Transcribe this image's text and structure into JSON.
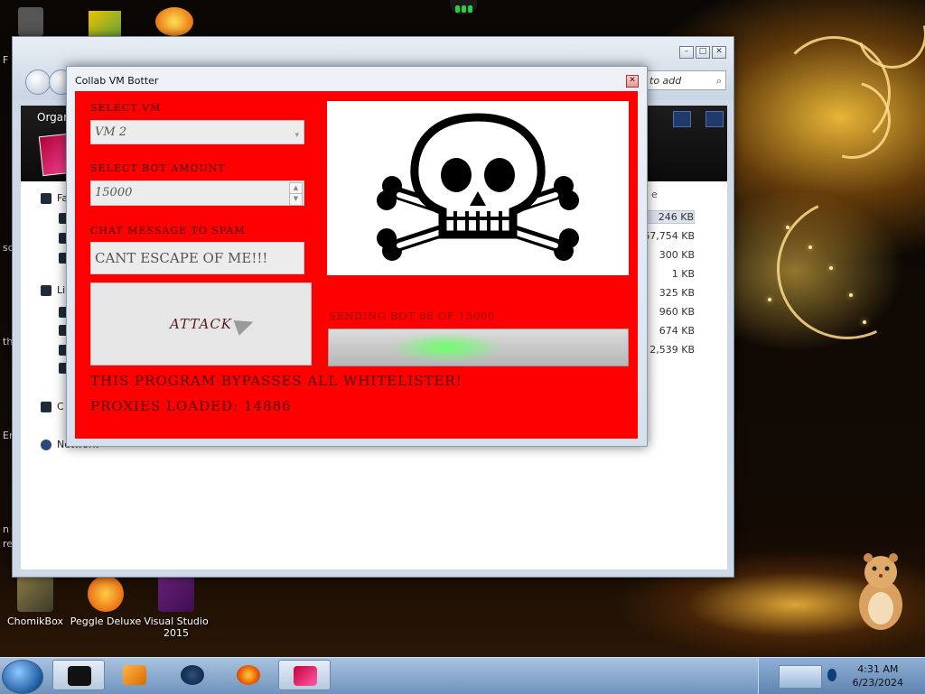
{
  "desktop": {
    "icons": [
      {
        "label": "ChomikBox"
      },
      {
        "label": "Peggle Deluxe"
      },
      {
        "label": "Visual Studio 2015"
      }
    ],
    "left_clipped": [
      "sc",
      "th",
      "Er",
      "n",
      "re",
      "F"
    ]
  },
  "explorer": {
    "search_placeholder": "to add",
    "organize": "Organ",
    "nav_items": [
      "Fa",
      "Li",
      "C",
      "Network"
    ],
    "column_partial": "e",
    "sizes": [
      "246 KB",
      "67,754 KB",
      "300 KB",
      "1 KB",
      "325 KB",
      "960 KB",
      "674 KB",
      "2,539 KB"
    ]
  },
  "botter": {
    "title": "Collab VM Botter",
    "select_vm_label": "SELECT VM",
    "select_vm_value": "VM 2",
    "bot_amount_label": "SELECT BOT AMOUNT",
    "bot_amount_value": "15000",
    "chat_label": "CHAT MESSAGE TO SPAM",
    "chat_value": "CANT ESCAPE OF ME!!!",
    "attack_label": "ATTACK",
    "status": "SENDING BOT 88 OF 15000",
    "progress": 0.0059,
    "bypass_text": "THIS PROGRAM BYPASSES ALL WHITELISTER!",
    "proxies_text": "PROXIES LOADED: 14886"
  },
  "taskbar": {
    "time": "4:31 AM",
    "date": "6/23/2024"
  }
}
